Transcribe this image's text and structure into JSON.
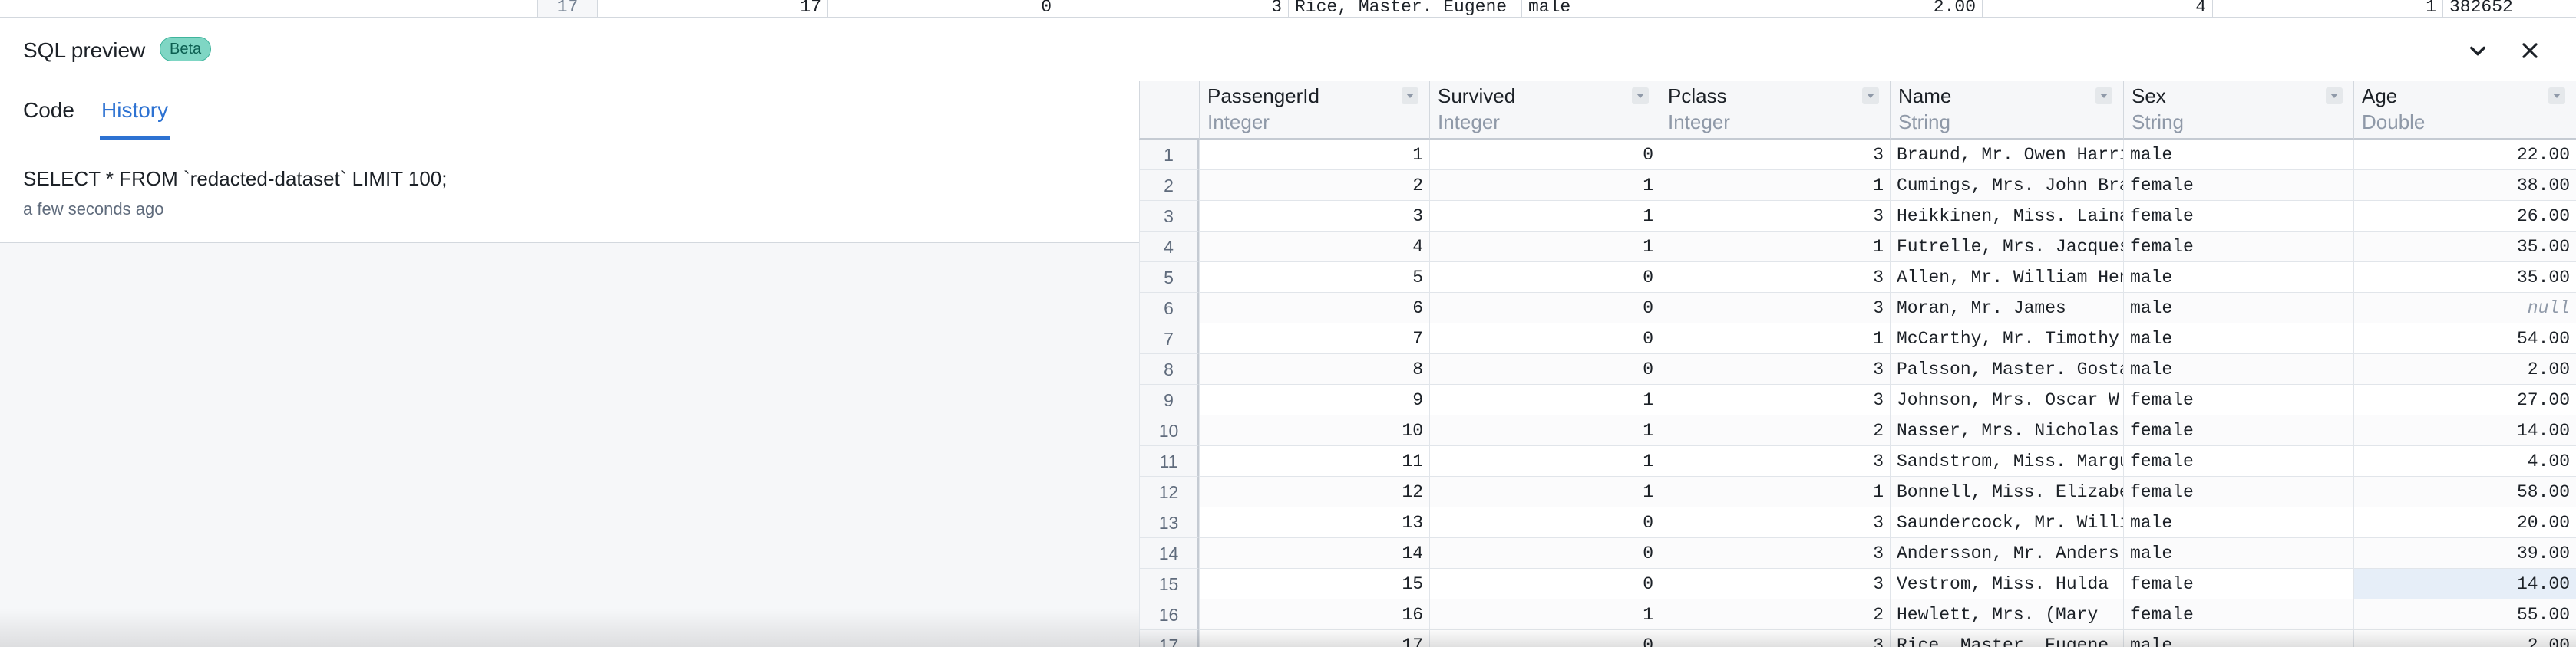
{
  "background_row": {
    "row_number": "17",
    "cells": [
      "17",
      "0",
      "3",
      "Rice, Master. Eugene",
      "male",
      "2.00",
      "4",
      "1",
      "382652"
    ]
  },
  "panel": {
    "title": "SQL preview",
    "badge": "Beta",
    "collapse_icon": "chevron-down-icon",
    "close_icon": "close-icon"
  },
  "tabs": [
    {
      "label": "Code",
      "active": false
    },
    {
      "label": "History",
      "active": true
    }
  ],
  "history": [
    {
      "sql": "SELECT * FROM `redacted-dataset` LIMIT 100;",
      "time": "a few seconds ago"
    }
  ],
  "grid": {
    "columns": [
      {
        "name": "PassengerId",
        "type": "Integer"
      },
      {
        "name": "Survived",
        "type": "Integer"
      },
      {
        "name": "Pclass",
        "type": "Integer"
      },
      {
        "name": "Name",
        "type": "String"
      },
      {
        "name": "Sex",
        "type": "String"
      },
      {
        "name": "Age",
        "type": "Double"
      }
    ],
    "rows": [
      [
        "1",
        "0",
        "3",
        "Braund, Mr. Owen Harris",
        "male",
        "22.00"
      ],
      [
        "2",
        "1",
        "1",
        "Cumings, Mrs. John Bradley",
        "female",
        "38.00"
      ],
      [
        "3",
        "1",
        "3",
        "Heikkinen, Miss. Laina",
        "female",
        "26.00"
      ],
      [
        "4",
        "1",
        "1",
        "Futrelle, Mrs. Jacques",
        "female",
        "35.00"
      ],
      [
        "5",
        "0",
        "3",
        "Allen, Mr. William Henry",
        "male",
        "35.00"
      ],
      [
        "6",
        "0",
        "3",
        "Moran, Mr. James",
        "male",
        "null"
      ],
      [
        "7",
        "0",
        "1",
        "McCarthy, Mr. Timothy",
        "male",
        "54.00"
      ],
      [
        "8",
        "0",
        "3",
        "Palsson, Master. Gosta",
        "male",
        "2.00"
      ],
      [
        "9",
        "1",
        "3",
        "Johnson, Mrs. Oscar W",
        "female",
        "27.00"
      ],
      [
        "10",
        "1",
        "2",
        "Nasser, Mrs. Nicholas",
        "female",
        "14.00"
      ],
      [
        "11",
        "1",
        "3",
        "Sandstrom, Miss. Marguerite",
        "female",
        "4.00"
      ],
      [
        "12",
        "1",
        "1",
        "Bonnell, Miss. Elizabeth",
        "female",
        "58.00"
      ],
      [
        "13",
        "0",
        "3",
        "Saundercock, Mr. William",
        "male",
        "20.00"
      ],
      [
        "14",
        "0",
        "3",
        "Andersson, Mr. Anders",
        "male",
        "39.00"
      ],
      [
        "15",
        "0",
        "3",
        "Vestrom, Miss. Hulda",
        "female",
        "14.00"
      ],
      [
        "16",
        "1",
        "2",
        "Hewlett, Mrs. (Mary",
        "female",
        "55.00"
      ],
      [
        "17",
        "0",
        "3",
        "Rice, Master. Eugene",
        "male",
        "2.00"
      ]
    ],
    "selected_cell": {
      "row": 15,
      "col": 6
    }
  }
}
